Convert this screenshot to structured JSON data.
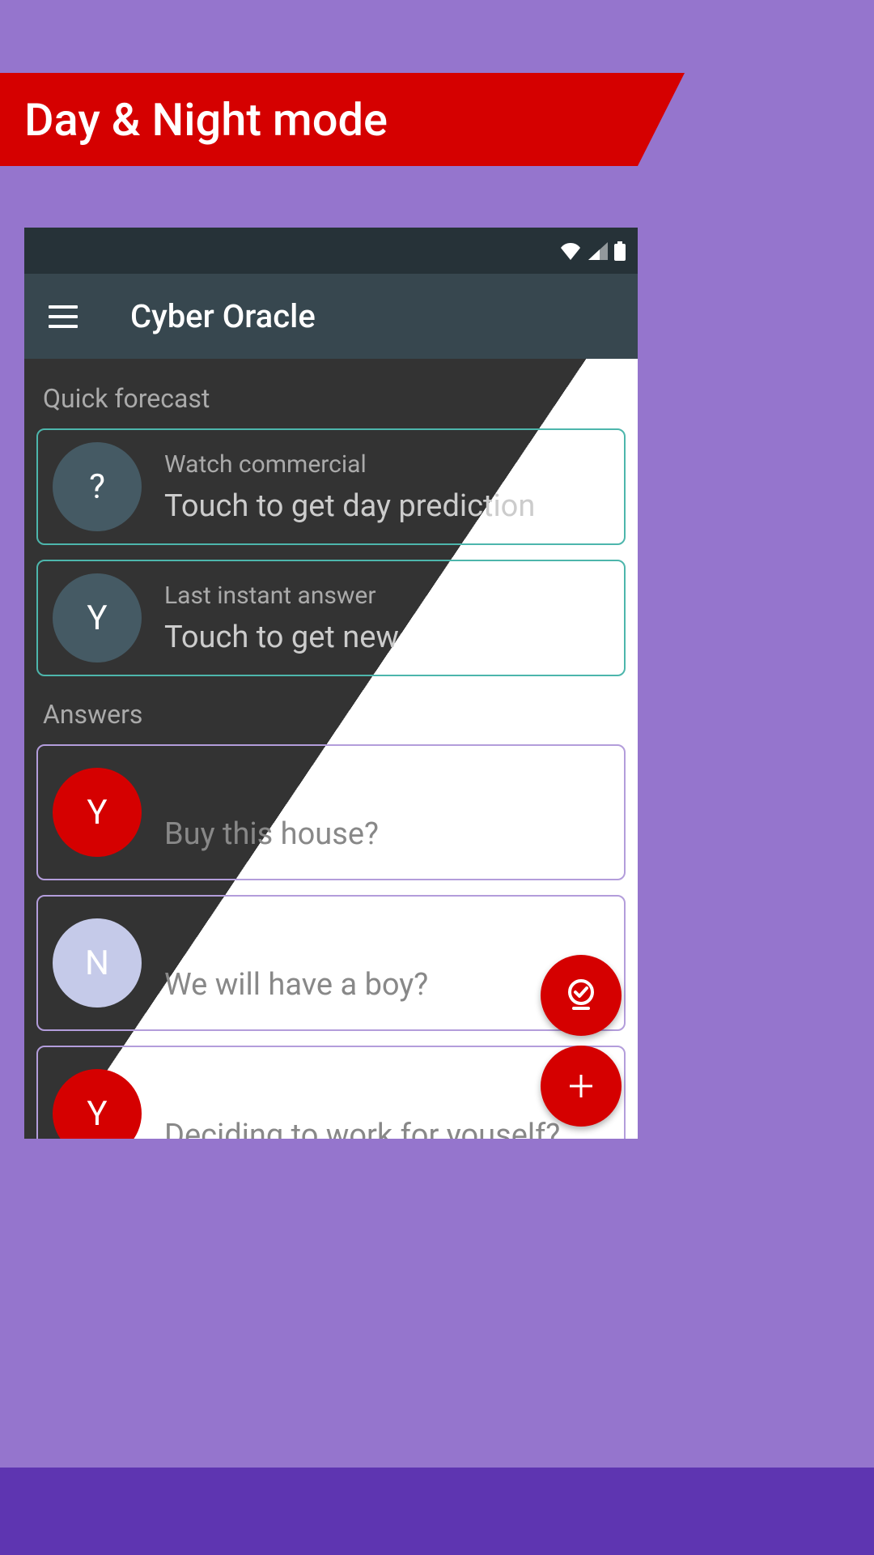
{
  "banner": {
    "title": "Day & Night mode"
  },
  "app": {
    "title": "Cyber Oracle"
  },
  "sections": {
    "quick_forecast": {
      "label": "Quick forecast",
      "cards": [
        {
          "circle_letter": "?",
          "small": "Watch commercial",
          "big": "Touch to get day prediction"
        },
        {
          "circle_letter": "Y",
          "small": "Last instant answer",
          "big": "Touch to get new"
        }
      ]
    },
    "answers": {
      "label": "Answers",
      "items": [
        {
          "circle_letter": "Y",
          "circle_color": "red",
          "text": "Buy this house?"
        },
        {
          "circle_letter": "N",
          "circle_color": "lav",
          "text": "We will have a boy?"
        },
        {
          "circle_letter": "Y",
          "circle_color": "red",
          "text": "Deciding to work for youself?"
        }
      ]
    }
  },
  "fab": {
    "check": "check",
    "add": "add"
  }
}
